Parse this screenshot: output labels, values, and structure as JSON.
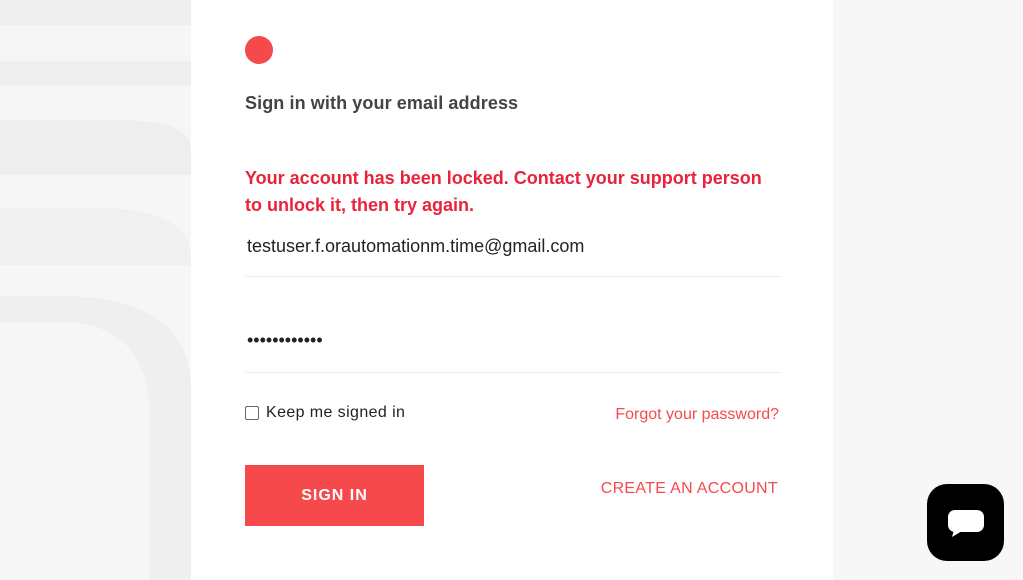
{
  "login": {
    "heading": "Sign in with your email address",
    "error_message": "Your account has been locked. Contact your support person to unlock it, then try again.",
    "email_value": "testuser.f.orautomationm.time@gmail.com",
    "password_value": "••••••••••••",
    "keep_signed_in_label": "Keep me signed in",
    "keep_signed_in_checked": false,
    "forgot_password_label": "Forgot your password?",
    "sign_in_label": "SIGN IN",
    "create_account_label": "CREATE AN ACCOUNT"
  },
  "chat": {
    "icon": "chat-bubble-icon"
  },
  "colors": {
    "accent": "#f6494b",
    "error": "#e8233a",
    "heading": "#444444",
    "chat_button": "#000000"
  }
}
